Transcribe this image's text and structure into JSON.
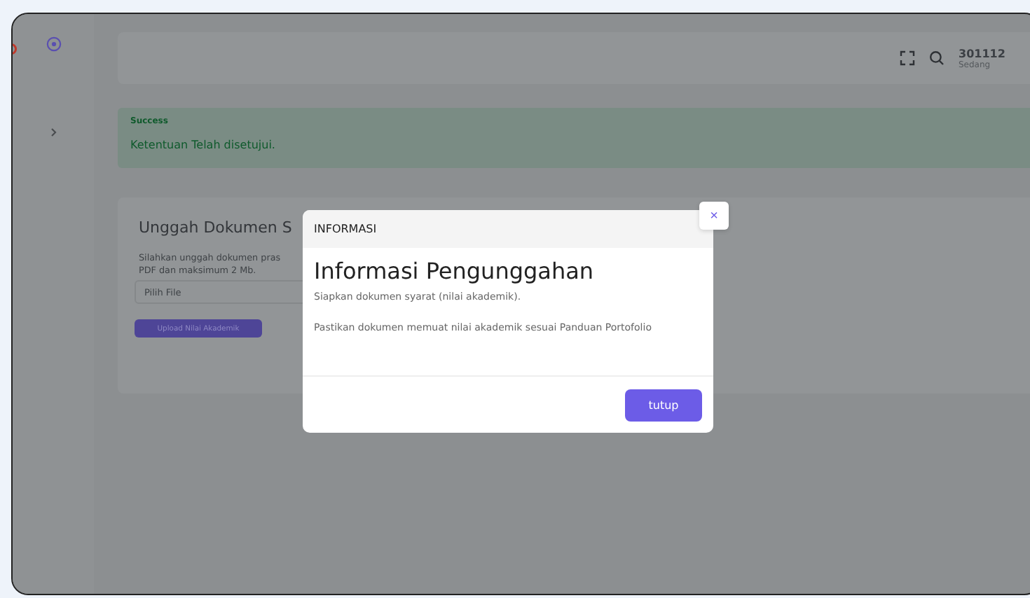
{
  "header": {
    "user_id": "301112",
    "user_status": "Sedang"
  },
  "alert": {
    "title": "Success",
    "message": "Ketentuan Telah disetujui."
  },
  "upload_card": {
    "title": "Unggah Dokumen S",
    "description_lines": [
      "Silahkan unggah dokumen pras",
      "PDF dan maksimum 2 Mb."
    ],
    "file_field": {
      "placeholder": "Pilih File"
    },
    "submit_button": "Upload Nilai Akademik"
  },
  "modal": {
    "header": "INFORMASI",
    "close": "×",
    "title": "Informasi Pengunggahan",
    "paragraphs": [
      "Siapkan dokumen syarat (nilai akademik).",
      "Pastikan dokumen memuat nilai akademik sesuai Panduan Portofolio"
    ],
    "buttons": [
      "tutup"
    ]
  }
}
